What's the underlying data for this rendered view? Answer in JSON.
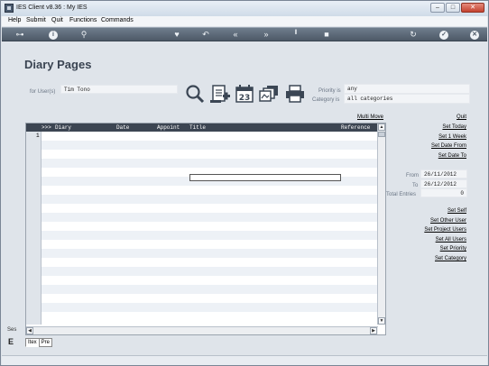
{
  "window": {
    "title": "IES Client v8.36 : My IES",
    "buttons": [
      "–",
      "□",
      "✕"
    ]
  },
  "menu": {
    "items": [
      "Help",
      "Submit",
      "Quit",
      "Functions",
      "Commands"
    ]
  },
  "toolbar": {
    "icons": [
      "key-icon",
      "info-icon",
      "search-icon",
      "heart-icon",
      "undo-icon",
      "rewind-icon",
      "forward-icon",
      "pin-icon",
      "stop-icon",
      "refresh-icon",
      "check-icon",
      "close-icon"
    ]
  },
  "page": {
    "title": "Diary Pages",
    "for_users_label": "for User(s)",
    "for_users_value": "Tim Tono",
    "priority_label": "Priority is",
    "priority_value": "any",
    "category_label": "Category is",
    "category_value": "all categories",
    "multi_move": "Multi Move"
  },
  "grid": {
    "columns": [
      ">>>",
      "Diary",
      "Date",
      "Appoint",
      "Title",
      "Reference"
    ],
    "rows": [
      {
        "num": "1",
        "diary": "",
        "date": "",
        "appoint": "",
        "title": "",
        "reference": ""
      }
    ]
  },
  "date_range": {
    "from_label": "From",
    "from_value": "26/11/2012",
    "to_label": "To",
    "to_value": "26/12/2012",
    "total_label": "Total Entries",
    "total_value": "0"
  },
  "actions_top": [
    "Quit",
    "Set Today",
    "Set 1 Week",
    "Set Date From",
    "Set Date To"
  ],
  "actions_bottom": [
    "Set Self",
    "Set Other User",
    "Set Project Users",
    "Set All Users",
    "Set Priority",
    "Set Category"
  ],
  "tabs": [
    "Itex",
    "Pre"
  ],
  "side": {
    "stub_text": "Ses",
    "stub_glyph": "E"
  }
}
